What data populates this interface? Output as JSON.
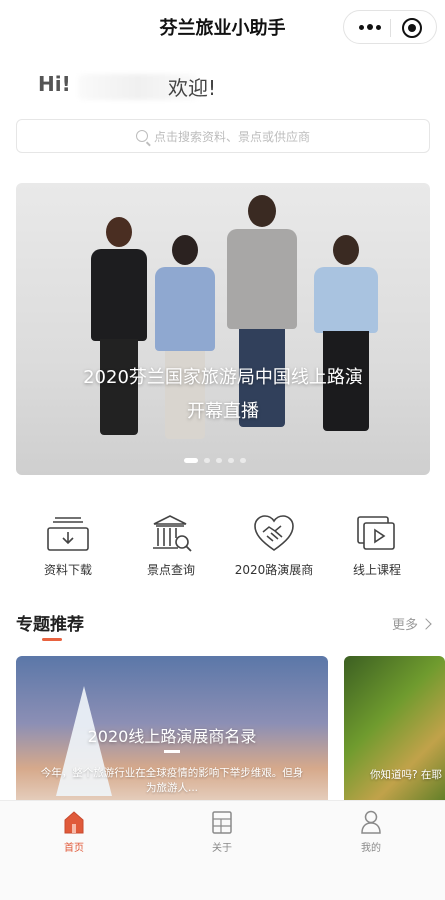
{
  "app": {
    "title": "芬兰旅业小助手"
  },
  "capsule": {
    "more_icon": "more-dots-icon",
    "close_icon": "target-icon"
  },
  "greeting": {
    "hi": "Hi!",
    "welcome": "欢迎!"
  },
  "search": {
    "placeholder": "点击搜索资料、景点或供应商",
    "icon": "search-icon"
  },
  "banner": {
    "caption_line1": "2020芬兰国家旅游局中国线上路演",
    "caption_line2": "开幕直播",
    "slide_count": 5,
    "active_slide": 1
  },
  "quick_links": [
    {
      "label": "资料下载",
      "icon": "download-tray-icon"
    },
    {
      "label": "景点查询",
      "icon": "museum-search-icon"
    },
    {
      "label": "2020路演展商",
      "icon": "handshake-heart-icon"
    },
    {
      "label": "线上课程",
      "icon": "video-play-icon"
    }
  ],
  "section": {
    "title": "专题推荐",
    "more": "更多"
  },
  "cards": [
    {
      "title": "2020线上路演展商名录",
      "desc": "今年，整个旅游行业在全球疫情的影响下举步维艰。但身为旅游人..."
    },
    {
      "desc": "你知道吗? 在耶"
    }
  ],
  "tabbar": [
    {
      "label": "首页",
      "icon": "home-icon",
      "active": true
    },
    {
      "label": "关于",
      "icon": "document-icon",
      "active": false
    },
    {
      "label": "我的",
      "icon": "user-icon",
      "active": false
    }
  ],
  "colors": {
    "accent": "#e05a3a",
    "section_bar": "#e8623f",
    "text": "#333333"
  }
}
